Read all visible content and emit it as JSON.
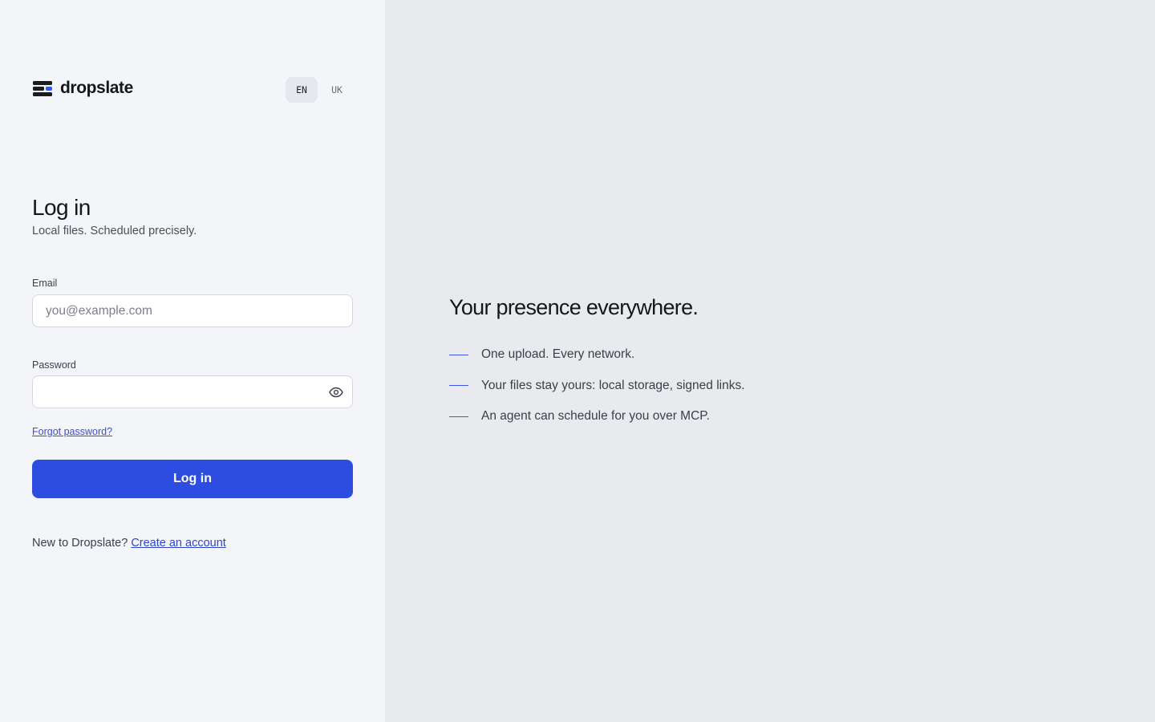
{
  "brand": {
    "name": "dropslate",
    "accent": "#3a57e8"
  },
  "language": {
    "options": [
      {
        "code": "EN",
        "active": true
      },
      {
        "code": "UK",
        "active": false
      }
    ]
  },
  "login": {
    "title": "Log in",
    "subtitle": "Local files. Scheduled precisely.",
    "email": {
      "label": "Email",
      "placeholder": "you@example.com",
      "value": ""
    },
    "password": {
      "label": "Password",
      "value": "",
      "toggle_icon": "eye-icon"
    },
    "forgot_link": "Forgot password?",
    "submit_label": "Log in",
    "signup_prompt": "New to Dropslate?",
    "signup_link": "Create an account",
    "button_color": "#2d4de0"
  },
  "promo": {
    "tagline": "Your presence everywhere.",
    "features": [
      "One upload. Every network.",
      "Your files stay yours: local storage, signed links.",
      "An agent can schedule for you over MCP."
    ]
  }
}
